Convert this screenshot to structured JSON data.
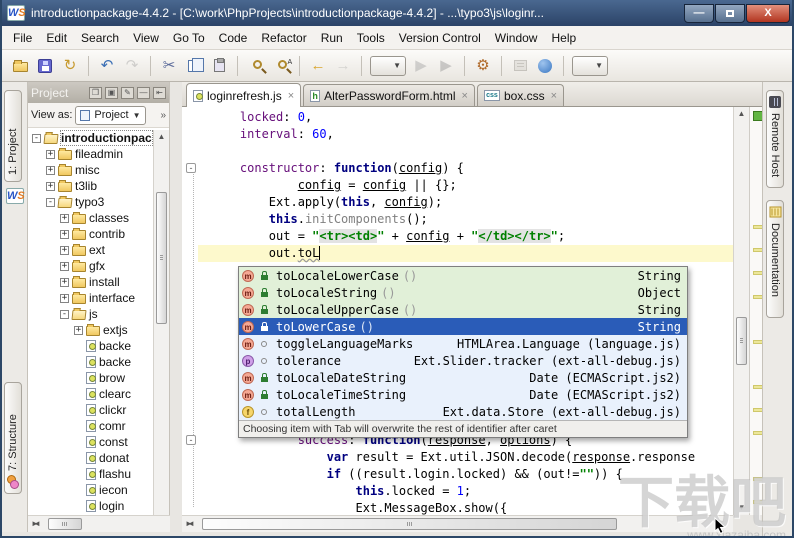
{
  "colors": {
    "sel": "#2a5cb8",
    "rowgreen": "#e1f0d8",
    "rowblue": "#e9f1fc",
    "curline": "#fdf9cc",
    "kw": "#000080",
    "prop": "#660e7a",
    "num": "#0000ff",
    "str": "#008000"
  },
  "window": {
    "title": "introductionpackage-4.4.2 - [C:\\work\\PhpProjects\\introductionpackage-4.4.2] - ...\\typo3\\js\\loginr...",
    "minimize_label": "—",
    "close_label": "X"
  },
  "menu": {
    "items": [
      "File",
      "Edit",
      "Search",
      "View",
      "Go To",
      "Code",
      "Refactor",
      "Run",
      "Tools",
      "Version Control",
      "Window",
      "Help"
    ]
  },
  "toolbar": {
    "items": [
      {
        "name": "open-button",
        "icon": "g-folder"
      },
      {
        "name": "save-button",
        "icon": "g-floppy"
      },
      {
        "name": "synchronize-button",
        "icon": "glyph",
        "glyph": "↻",
        "color": "#c79a2e"
      },
      {
        "name": "sep-1",
        "type": "sep"
      },
      {
        "name": "undo-button",
        "icon": "glyph",
        "glyph": "↶",
        "color": "#3b6fb5"
      },
      {
        "name": "redo-button",
        "icon": "glyph",
        "glyph": "↷",
        "color": "#9a9a9a",
        "enabled": false
      },
      {
        "name": "sep-2",
        "type": "sep"
      },
      {
        "name": "cut-button",
        "icon": "glyph",
        "glyph": "✂",
        "color": "#5a6a9a"
      },
      {
        "name": "copy-button",
        "icon": "g-copy"
      },
      {
        "name": "paste-button",
        "icon": "g-paste"
      },
      {
        "name": "sep-3",
        "type": "sep"
      },
      {
        "name": "find-button",
        "icon": "g-mag"
      },
      {
        "name": "replace-button",
        "icon": "g-mag repl"
      },
      {
        "name": "sep-4",
        "type": "sep"
      },
      {
        "name": "back-button",
        "icon": "glyph",
        "glyph": "←",
        "color": "#d9a62e"
      },
      {
        "name": "forward-button",
        "icon": "glyph",
        "glyph": "→",
        "color": "#aaaaaa",
        "enabled": false
      },
      {
        "name": "sep-5",
        "type": "sep"
      },
      {
        "name": "run-configuration-combo",
        "type": "combo"
      },
      {
        "name": "run-button",
        "icon": "glyph",
        "glyph": "▶",
        "color": "#9a9a9a",
        "enabled": false
      },
      {
        "name": "debug-button",
        "icon": "glyph",
        "glyph": "▶",
        "color": "#8a8a8a",
        "enabled": false
      },
      {
        "name": "sep-6",
        "type": "sep"
      },
      {
        "name": "settings-button",
        "icon": "glyph",
        "glyph": "⚙",
        "color": "#b06a2a"
      },
      {
        "name": "sep-7",
        "type": "sep"
      },
      {
        "name": "export-settings-button",
        "icon": "g-export",
        "enabled": false
      },
      {
        "name": "help-button",
        "icon": "g-help"
      },
      {
        "name": "sep-8",
        "type": "sep"
      },
      {
        "name": "more-actions-combo",
        "type": "combo"
      }
    ]
  },
  "left_stripe": {
    "project_tab": "1: Project",
    "structure_tab": "7: Structure"
  },
  "right_stripe": {
    "tabs": [
      {
        "label": "Remote Host",
        "icon": "server"
      },
      {
        "label": "Documentation",
        "icon": "doc"
      }
    ]
  },
  "project": {
    "header_title": "Project",
    "view_as_label": "View as:",
    "view_as_value": "Project",
    "view_as_arrow": "▼",
    "more_chevron": "»",
    "tree": [
      {
        "label": "introductionpac",
        "lvl": 0,
        "exp": "minus",
        "icon": "folder-open",
        "bold": true
      },
      {
        "label": "fileadmin",
        "lvl": 1,
        "exp": "plus",
        "icon": "folder"
      },
      {
        "label": "misc",
        "lvl": 1,
        "exp": "plus",
        "icon": "folder"
      },
      {
        "label": "t3lib",
        "lvl": 1,
        "exp": "plus",
        "icon": "folder"
      },
      {
        "label": "typo3",
        "lvl": 1,
        "exp": "minus",
        "icon": "folder-open"
      },
      {
        "label": "classes",
        "lvl": 2,
        "exp": "plus",
        "icon": "folder"
      },
      {
        "label": "contrib",
        "lvl": 2,
        "exp": "plus",
        "icon": "folder"
      },
      {
        "label": "ext",
        "lvl": 2,
        "exp": "plus",
        "icon": "folder"
      },
      {
        "label": "gfx",
        "lvl": 2,
        "exp": "plus",
        "icon": "folder"
      },
      {
        "label": "install",
        "lvl": 2,
        "exp": "plus",
        "icon": "folder"
      },
      {
        "label": "interface",
        "lvl": 2,
        "exp": "plus",
        "icon": "folder"
      },
      {
        "label": "js",
        "lvl": 2,
        "exp": "minus",
        "icon": "folder-open"
      },
      {
        "label": "extjs",
        "lvl": 3,
        "exp": "plus",
        "icon": "folder"
      },
      {
        "label": "backe",
        "lvl": 3,
        "icon": "js"
      },
      {
        "label": "backe",
        "lvl": 3,
        "icon": "js"
      },
      {
        "label": "brow",
        "lvl": 3,
        "icon": "js"
      },
      {
        "label": "clearc",
        "lvl": 3,
        "icon": "js"
      },
      {
        "label": "clickr",
        "lvl": 3,
        "icon": "js"
      },
      {
        "label": "comr",
        "lvl": 3,
        "icon": "js"
      },
      {
        "label": "const",
        "lvl": 3,
        "icon": "js"
      },
      {
        "label": "donat",
        "lvl": 3,
        "icon": "js"
      },
      {
        "label": "flashu",
        "lvl": 3,
        "icon": "js"
      },
      {
        "label": "iecon",
        "lvl": 3,
        "icon": "js"
      },
      {
        "label": "login",
        "lvl": 3,
        "icon": "js"
      }
    ]
  },
  "editor": {
    "tabs": [
      {
        "label": "loginrefresh.js",
        "icon": "js",
        "active": true,
        "close": "×"
      },
      {
        "label": "AlterPasswordForm.html",
        "icon": "html",
        "close": "×"
      },
      {
        "label": "box.css",
        "icon": "css",
        "close": "×"
      }
    ],
    "lines": [
      {
        "toks": [
          [
            "t",
            "    "
          ],
          [
            "p",
            "locked"
          ],
          [
            "t",
            ": "
          ],
          [
            "n",
            "0"
          ],
          [
            "t",
            ","
          ]
        ]
      },
      {
        "toks": [
          [
            "t",
            "    "
          ],
          [
            "p",
            "interval"
          ],
          [
            "t",
            ": "
          ],
          [
            "n",
            "60"
          ],
          [
            "t",
            ","
          ]
        ]
      },
      {
        "toks": []
      },
      {
        "toks": [
          [
            "t",
            "    "
          ],
          [
            "p",
            "constructor"
          ],
          [
            "t",
            ": "
          ],
          [
            "k",
            "function"
          ],
          [
            "t",
            "("
          ],
          [
            "a",
            "config"
          ],
          [
            "t",
            ") {"
          ]
        ],
        "fold": true
      },
      {
        "toks": [
          [
            "t",
            "            "
          ],
          [
            "a",
            "config"
          ],
          [
            "t",
            " = "
          ],
          [
            "a",
            "config"
          ],
          [
            "t",
            " || {};"
          ]
        ]
      },
      {
        "toks": [
          [
            "t",
            "        Ext.apply("
          ],
          [
            "k",
            "this"
          ],
          [
            "t",
            ", "
          ],
          [
            "a",
            "config"
          ],
          [
            "t",
            ");"
          ]
        ]
      },
      {
        "toks": [
          [
            "t",
            "        "
          ],
          [
            "k",
            "this"
          ],
          [
            "t",
            "."
          ],
          [
            "g",
            "initComponents"
          ],
          [
            "t",
            "();"
          ]
        ]
      },
      {
        "toks": [
          [
            "t",
            "        out = "
          ],
          [
            "s",
            "\""
          ],
          [
            "i",
            "<tr><td>"
          ],
          [
            "s",
            "\""
          ],
          [
            "t",
            " + "
          ],
          [
            "a",
            "config"
          ],
          [
            "t",
            " + "
          ],
          [
            "s",
            "\""
          ],
          [
            "i",
            "</td></tr>"
          ],
          [
            "s",
            "\""
          ],
          [
            "t",
            ";"
          ]
        ]
      },
      {
        "toks": [
          [
            "t",
            "        out."
          ],
          [
            "w",
            "toL"
          ]
        ],
        "cur": true,
        "caret": true
      },
      {
        "toks": []
      },
      {
        "toks": []
      },
      {
        "toks": []
      },
      {
        "toks": []
      },
      {
        "toks": []
      },
      {
        "toks": []
      },
      {
        "toks": []
      },
      {
        "toks": []
      },
      {
        "toks": []
      },
      {
        "toks": []
      },
      {
        "toks": [
          [
            "t",
            "            "
          ],
          [
            "p",
            "success"
          ],
          [
            "t",
            ": "
          ],
          [
            "k",
            "function"
          ],
          [
            "t",
            "("
          ],
          [
            "a",
            "response"
          ],
          [
            "t",
            ", "
          ],
          [
            "a",
            "options"
          ],
          [
            "t",
            ") {"
          ]
        ],
        "fold": true
      },
      {
        "toks": [
          [
            "t",
            "                "
          ],
          [
            "k",
            "var"
          ],
          [
            "t",
            " result = Ext.util.JSON.decode("
          ],
          [
            "a",
            "response"
          ],
          [
            "t",
            ".response"
          ]
        ]
      },
      {
        "toks": [
          [
            "t",
            "                "
          ],
          [
            "k",
            "if"
          ],
          [
            "t",
            " ((result.login.locked) && (out!="
          ],
          [
            "s",
            "\"\""
          ],
          [
            "t",
            ")) {"
          ]
        ]
      },
      {
        "toks": [
          [
            "t",
            "                    "
          ],
          [
            "k",
            "this"
          ],
          [
            "t",
            ".locked = "
          ],
          [
            "n",
            "1"
          ],
          [
            "t",
            ";"
          ]
        ]
      },
      {
        "toks": [
          [
            "t",
            "                    Ext.MessageBox.show({"
          ]
        ]
      }
    ],
    "stripe_marks": [
      118,
      141,
      164,
      188,
      233,
      278,
      301,
      324,
      370,
      393
    ]
  },
  "completion": {
    "items": [
      {
        "kind": "m",
        "vis": "lock",
        "name": "toLocaleLowerCase",
        "parens": "()",
        "detail": "String",
        "bg": "green"
      },
      {
        "kind": "m",
        "vis": "lock",
        "name": "toLocaleString",
        "parens": "()",
        "detail": "Object",
        "bg": "green"
      },
      {
        "kind": "m",
        "vis": "lock",
        "name": "toLocaleUpperCase",
        "parens": "()",
        "detail": "String",
        "bg": "green"
      },
      {
        "kind": "m",
        "vis": "lock",
        "name": "toLowerCase",
        "parens": "()",
        "detail": "String",
        "selected": true
      },
      {
        "kind": "m",
        "vis": "circle",
        "name": "toggleLanguageMarks",
        "detail": "HTMLArea.Language (language.js)",
        "bg": "blue"
      },
      {
        "kind": "p",
        "vis": "circle",
        "name": "tolerance",
        "detail": "Ext.Slider.tracker (ext-all-debug.js)",
        "bg": "blue"
      },
      {
        "kind": "m",
        "vis": "lock",
        "name": "toLocaleDateString",
        "detail": "Date (ECMAScript.js2)",
        "bg": "blue"
      },
      {
        "kind": "m",
        "vis": "lock",
        "name": "toLocaleTimeString",
        "detail": "Date (ECMAScript.js2)",
        "bg": "blue"
      },
      {
        "kind": "f",
        "vis": "circle",
        "name": "totalLength",
        "detail": "Ext.data.Store (ext-all-debug.js)",
        "bg": "blue"
      }
    ],
    "hint": "Choosing item with Tab will overwrite the rest of identifier after caret"
  },
  "watermark": {
    "title": "下载吧",
    "url": "www.xiazaiba.com"
  }
}
